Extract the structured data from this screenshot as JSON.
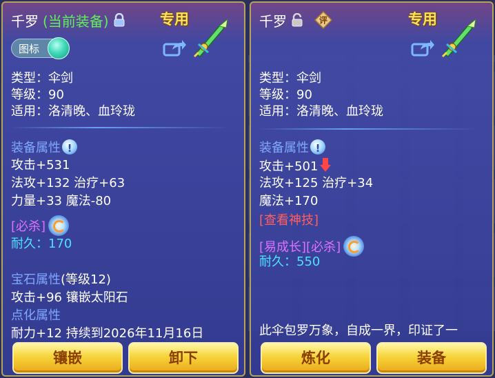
{
  "left_panel": {
    "name": "千罗",
    "status": "(当前装备)",
    "exclusive": "专用",
    "icon_toggle_label": "图标",
    "basic": [
      "类型：伞剑",
      "等级：90",
      "适用：洛清晚、血玲珑"
    ],
    "equip_attr_title": "装备属性",
    "stats": [
      "攻击+531",
      "法攻+132 治疗+63",
      "力量+33 魔法-80"
    ],
    "special": "[必杀]",
    "durability": "耐久：170",
    "gem_title": "宝石属性",
    "gem_level": "(等级12)",
    "gem_stat": "攻击+96 镶嵌太阳石",
    "dianhua_title": "点化属性",
    "dianhua_stat": "耐力+12 持续到2026年11月16日",
    "btn_left": "镶嵌",
    "btn_right": "卸下"
  },
  "right_panel": {
    "name": "千罗",
    "exclusive": "专用",
    "basic": [
      "类型：伞剑",
      "等级：90",
      "适用：洛清晚、血玲珑"
    ],
    "equip_attr_title": "装备属性",
    "stats": [
      "攻击+501",
      "法攻+125 治疗+34",
      "魔法+170"
    ],
    "view_skill": "[查看神技]",
    "special": "[易成长][必杀]",
    "durability": "耐久：550",
    "description": "此伞包罗万象，自成一界，印证了一",
    "btn_left": "炼化",
    "btn_right": "装备"
  },
  "colors": {
    "title_green": "#5ff05a",
    "section_blue": "#80a8ff",
    "cyan": "#4fe0ff",
    "purple": "#e070ff",
    "red": "#ff6060",
    "button_gold": "#f7d43a"
  },
  "icons": [
    "lock-icon",
    "unlock-icon",
    "evaluate-icon",
    "share-icon",
    "weapon-icon",
    "info-icon",
    "skill-swirl-icon",
    "down-arrow-icon"
  ]
}
